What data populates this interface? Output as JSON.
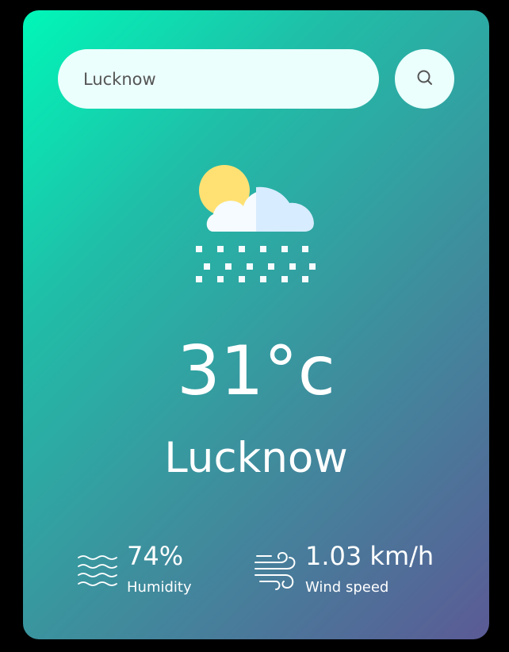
{
  "search": {
    "value": "Lucknow"
  },
  "weather": {
    "condition_icon": "sun-cloud-snow-icon",
    "temperature": "31°c",
    "city": "Lucknow"
  },
  "details": {
    "humidity": {
      "icon": "humidity-waves-icon",
      "value": "74%",
      "label": "Humidity"
    },
    "wind": {
      "icon": "wind-icon",
      "value": "1.03 km/h",
      "label": "Wind speed"
    }
  },
  "colors": {
    "gradient_start": "#00f7b8",
    "gradient_end": "#5b5a95",
    "input_bg": "#ebfffc",
    "text": "#ffffff"
  }
}
